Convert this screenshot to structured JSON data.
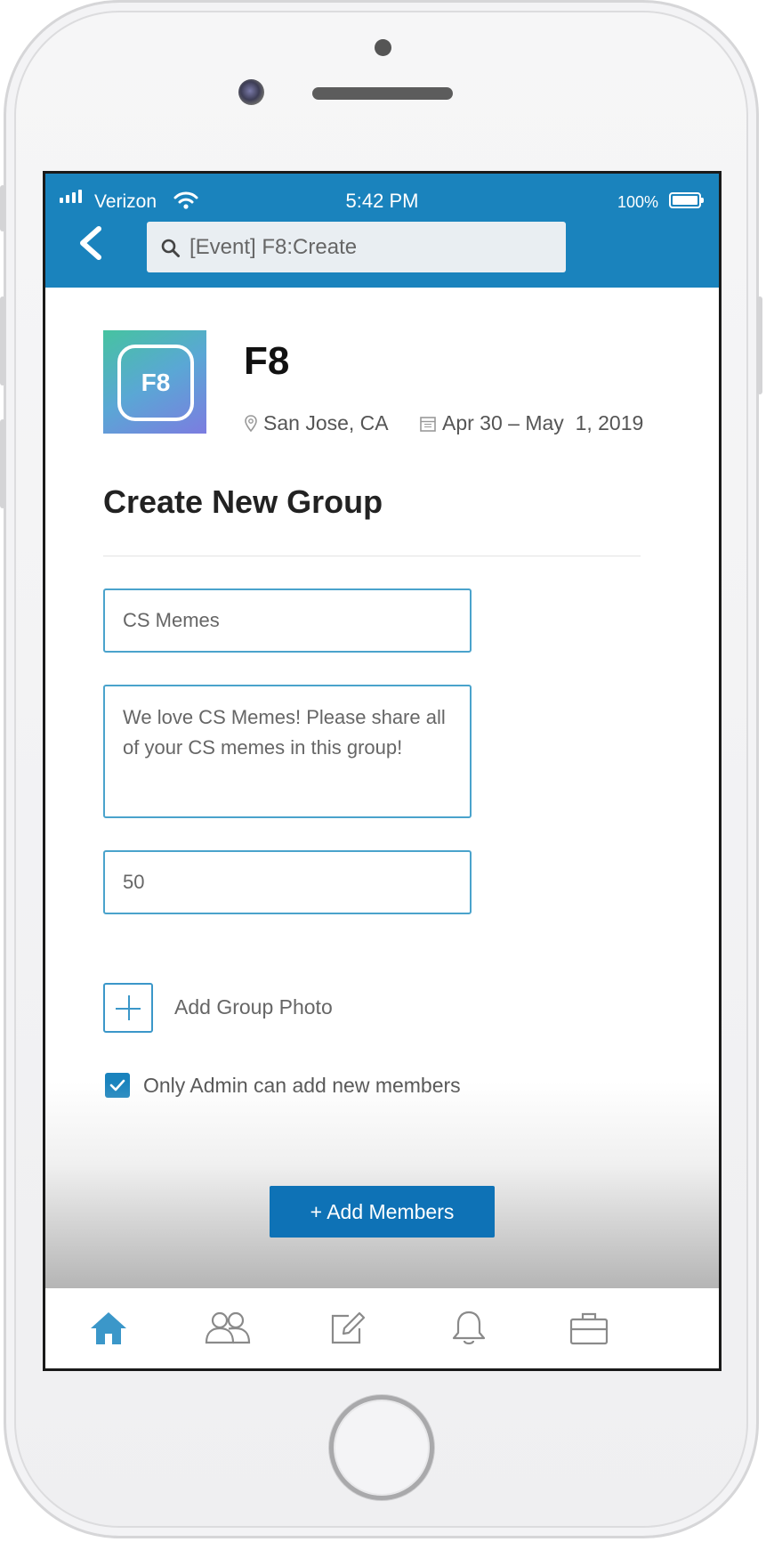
{
  "status_bar": {
    "carrier": "Verizon",
    "time": "5:42 PM",
    "battery": "100%"
  },
  "search": {
    "value": "[Event] F8:Create"
  },
  "event": {
    "logo_text": "F8",
    "title": "F8",
    "location": "San Jose, CA",
    "dates": "Apr 30 – May  1, 2019"
  },
  "form": {
    "title": "Create New Group",
    "group_name": "CS Memes",
    "description": "We love CS Memes! Please share all of your CS memes in this group!",
    "member_limit": "50",
    "add_photo_label": "Add Group Photo",
    "admin_only_label": "Only Admin can add new members",
    "admin_only_checked": true,
    "add_members_label": "+ Add Members"
  },
  "tabbar": {
    "items": [
      {
        "icon": "home-icon",
        "active": true
      },
      {
        "icon": "people-icon",
        "active": false
      },
      {
        "icon": "edit-icon",
        "active": false
      },
      {
        "icon": "bell-icon",
        "active": false
      },
      {
        "icon": "briefcase-icon",
        "active": false
      }
    ]
  },
  "colors": {
    "header": "#1a83bd",
    "primary_button": "#0e72b6",
    "active_tab": "#3b97c9",
    "inactive_tab": "#8a8a8a"
  }
}
